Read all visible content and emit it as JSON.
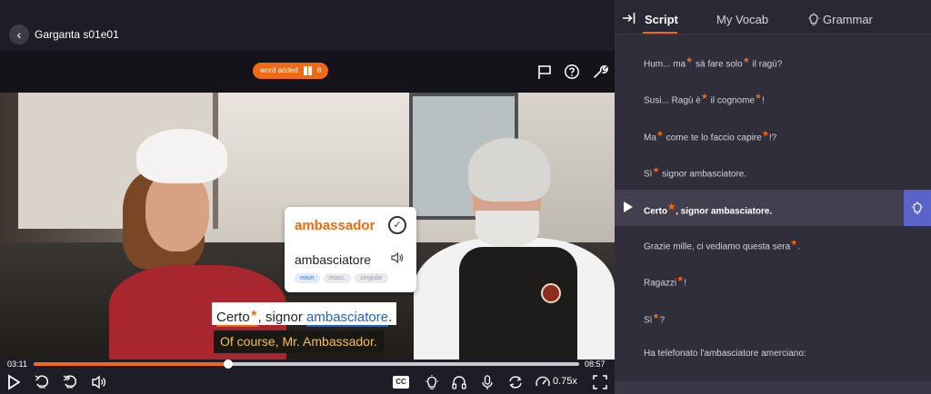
{
  "header": {
    "back_icon": "chevron-left-icon",
    "title": "Garganta s01e01"
  },
  "player_toolbar": {
    "word_added_label": "word added",
    "word_added_count": "8",
    "icons": [
      "flag-icon",
      "help-icon",
      "wrench-icon"
    ]
  },
  "popup": {
    "translation": "ambassador",
    "word": "ambasciatore",
    "tags": [
      "noun",
      "masc.",
      "singular"
    ]
  },
  "subtitle": {
    "italian_word1": "Certo",
    "italian_mid": ", signor ",
    "italian_word2": "ambasciatore",
    "italian_end": ".",
    "english": "Of course, Mr. Ambassador."
  },
  "playback": {
    "current_time": "03:11",
    "total_time": "08:57",
    "progress_fraction": 0.356,
    "cc_label": "CC",
    "speed": "0.75x"
  },
  "tabs": {
    "script": "Script",
    "vocab": "My Vocab",
    "grammar": "Grammar"
  },
  "script_lines": [
    {
      "t": [
        "Hum... ma",
        "★",
        " sà fare solo",
        "★",
        " il ragù?"
      ]
    },
    {
      "t": [
        "Susi... Ragù è",
        "★",
        " il cognome",
        "★",
        "!"
      ]
    },
    {
      "t": [
        "Ma",
        "★",
        " come te lo faccio capire",
        "★",
        "!?"
      ]
    },
    {
      "t": [
        "Sì",
        "★",
        " signor ambasciatore."
      ]
    },
    {
      "t": [
        "Grazie mille, ci vediamo questa sera",
        "★",
        "."
      ]
    },
    {
      "t": [
        "Ragazzi",
        "★",
        "!"
      ]
    },
    {
      "t": [
        "Sì",
        "★",
        "?"
      ]
    },
    {
      "t": [
        "Ha telefonato l'ambasciatore amerciano:"
      ]
    }
  ],
  "active_line": {
    "before": "Certo",
    "star": "★",
    "after": ", signor ambasciatore."
  },
  "colors": {
    "accent": "#f06a14",
    "grammar_button": "#5a63c9",
    "panel_bg": "#302e3b"
  }
}
